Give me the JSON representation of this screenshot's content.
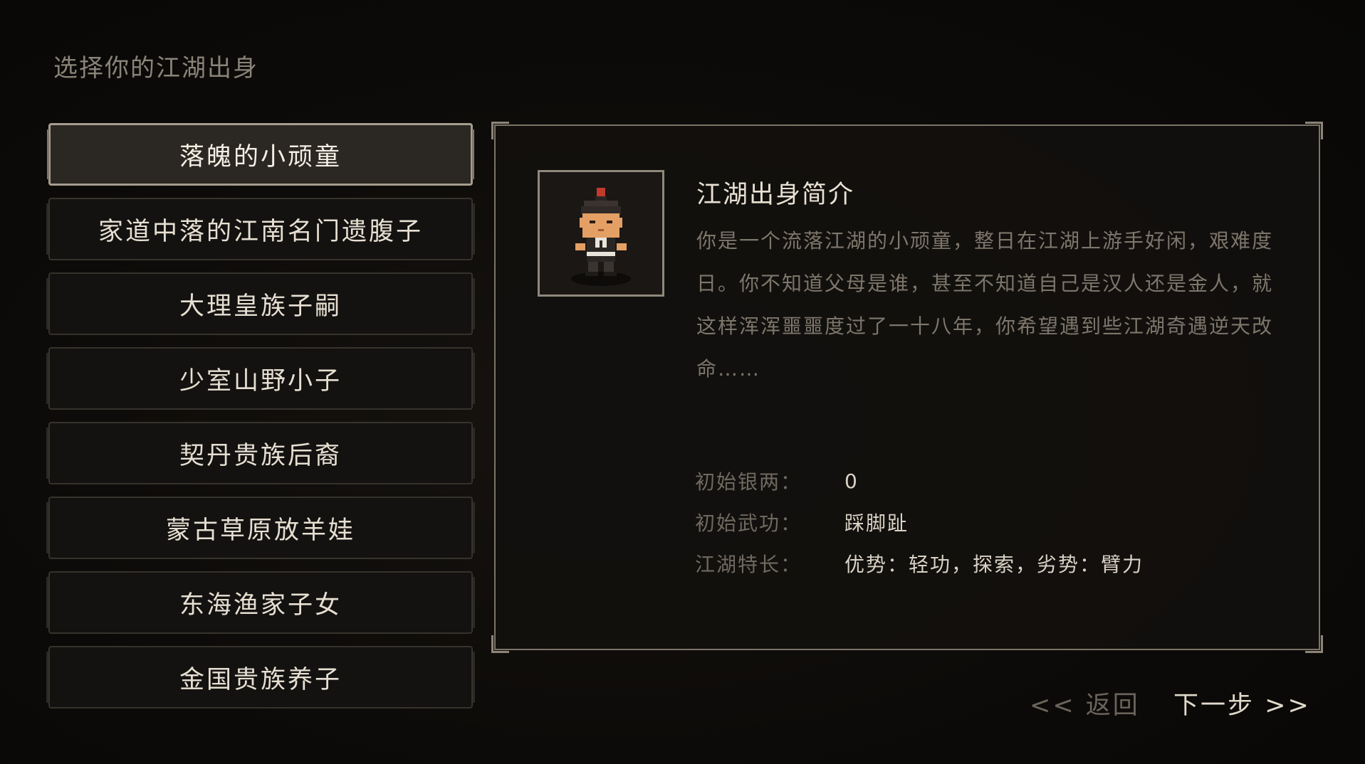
{
  "page": {
    "title": "选择你的江湖出身"
  },
  "origins": [
    {
      "label": "落魄的小顽童",
      "selected": true
    },
    {
      "label": "家道中落的江南名门遗腹子",
      "selected": false
    },
    {
      "label": "大理皇族子嗣",
      "selected": false
    },
    {
      "label": "少室山野小子",
      "selected": false
    },
    {
      "label": "契丹贵族后裔",
      "selected": false
    },
    {
      "label": "蒙古草原放羊娃",
      "selected": false
    },
    {
      "label": "东海渔家子女",
      "selected": false
    },
    {
      "label": "金国贵族养子",
      "selected": false
    }
  ],
  "detail": {
    "portrait_icon": "child-character-sprite",
    "title": "江湖出身简介",
    "description": "你是一个流落江湖的小顽童，整日在江湖上游手好闲，艰难度日。你不知道父母是谁，甚至不知道自己是汉人还是金人，就这样浑浑噩噩度过了一十八年，你希望遇到些江湖奇遇逆天改命……",
    "stats": [
      {
        "label": "初始银两：",
        "value": "0"
      },
      {
        "label": "初始武功：",
        "value": "踩脚趾"
      },
      {
        "label": "江湖特长：",
        "value": "优势：轻功，探索，劣势：臂力"
      }
    ]
  },
  "nav": {
    "back_label": "<< 返回",
    "next_label": "下一步 >>"
  },
  "colors": {
    "background": "#0c0a09",
    "selected_border": "#a59d8e",
    "text_primary": "#e6dfd2",
    "text_muted": "#7d766b"
  }
}
